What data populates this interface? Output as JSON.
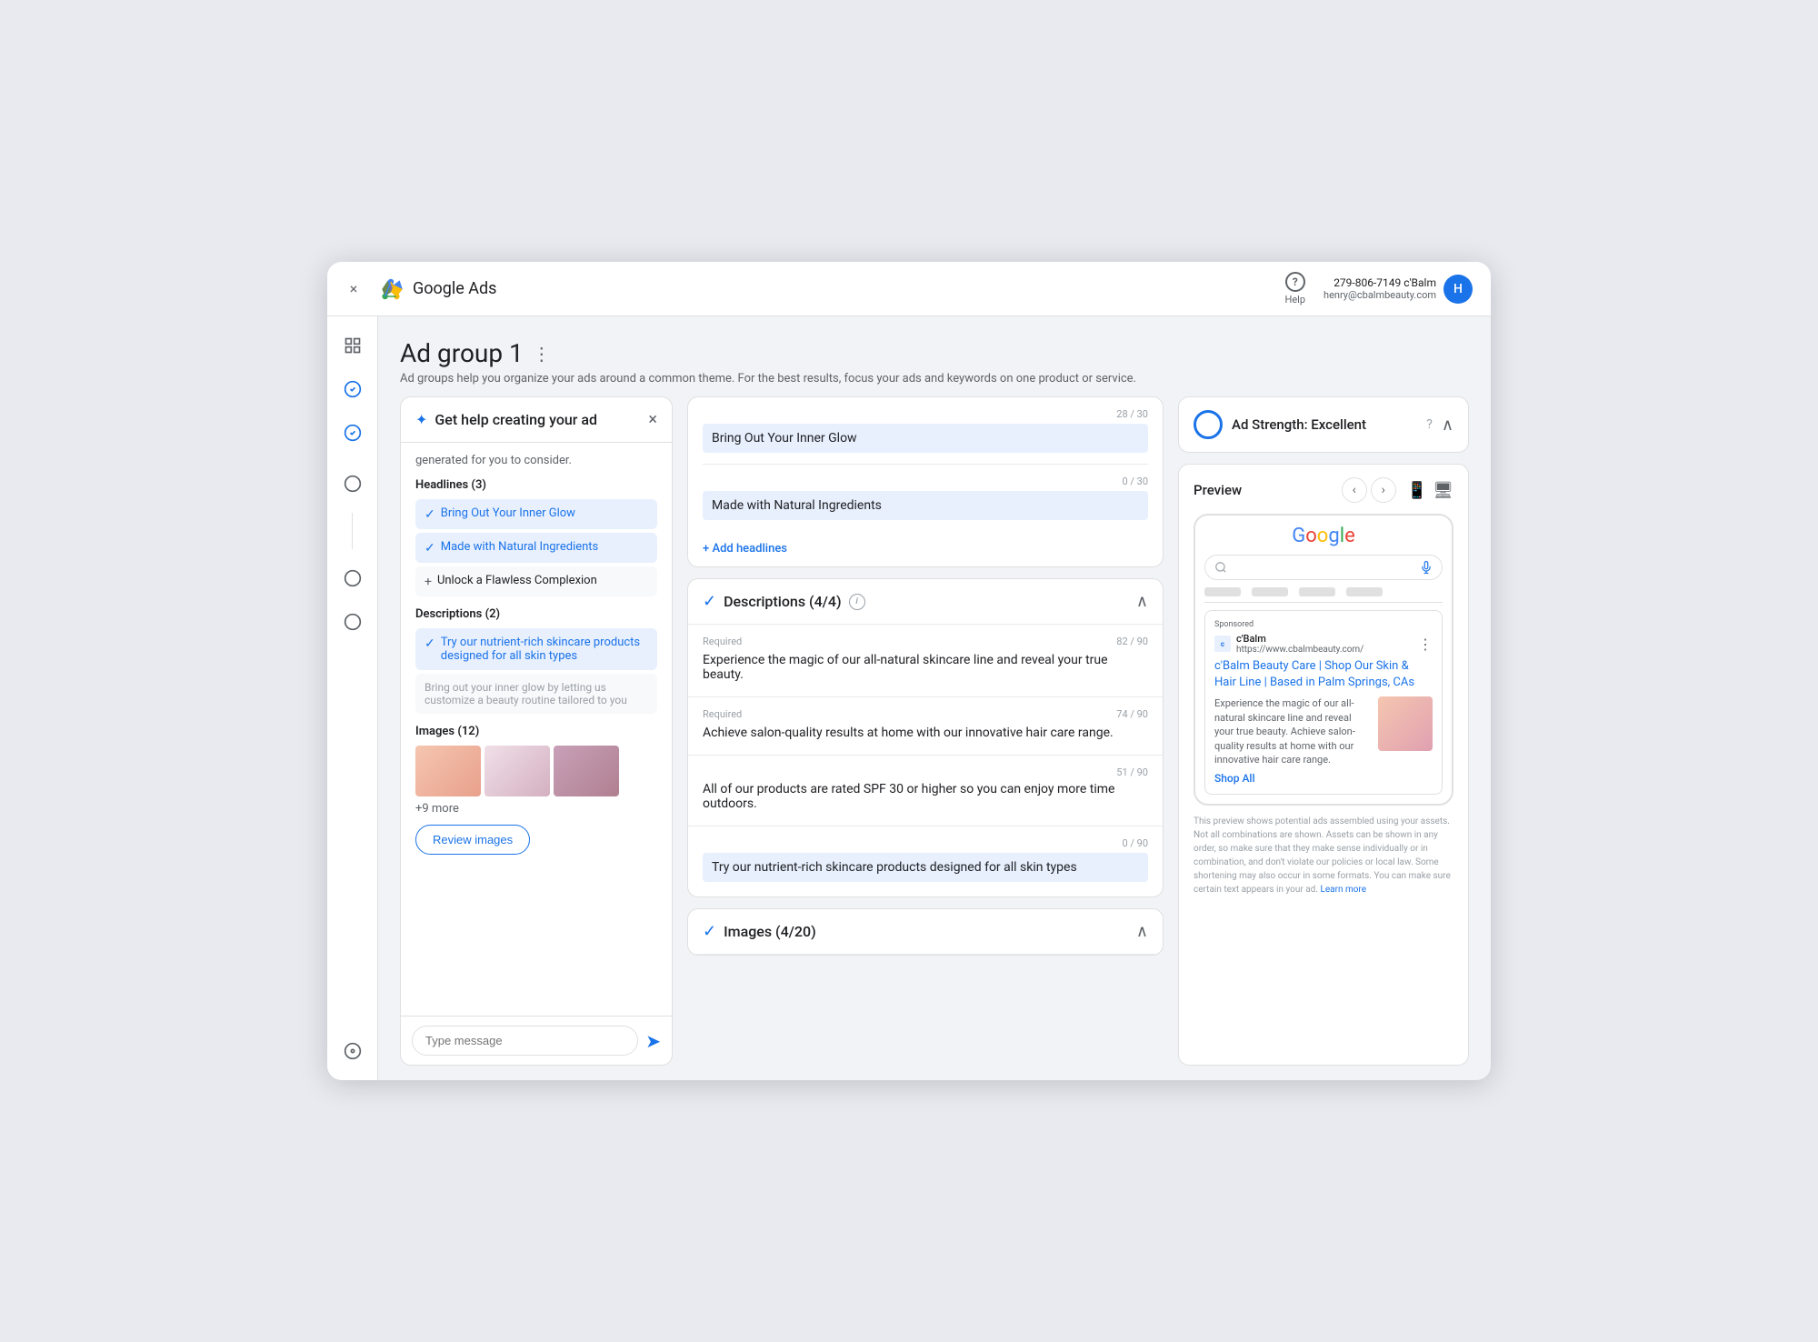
{
  "topbar": {
    "close_label": "×",
    "logo_text": "Google Ads",
    "help_label": "Help",
    "account_phone": "279-806-7149 c'Balm",
    "account_email": "henry@cbalmbeauty.com",
    "account_initial": "H"
  },
  "sidebar": {
    "icons": [
      "☰",
      "✓",
      "✓",
      "○",
      "○",
      "○"
    ]
  },
  "page": {
    "title": "Ad group 1",
    "subtitle": "Ad groups help you organize your ads around a common theme. For the best results, focus your ads and keywords on one product or service."
  },
  "left_panel": {
    "title": "Get help creating your ad",
    "generated_text": "generated for you to consider.",
    "headlines_label": "Headlines (3)",
    "headlines": [
      {
        "text": "Bring Out Your Inner Glow",
        "selected": true
      },
      {
        "text": "Made with Natural Ingredients",
        "selected": true
      },
      {
        "text": "Unlock a Flawless Complexion",
        "selected": false
      }
    ],
    "descriptions_label": "Descriptions (2)",
    "descriptions": [
      {
        "text": "Try our nutrient-rich skincare products designed for all skin types",
        "selected": true
      },
      {
        "text": "Bring out your inner glow by letting us customize a beauty routine tailored to you",
        "selected": false
      }
    ],
    "images_label": "Images (12)",
    "more_images": "+9 more",
    "review_button": "Review images",
    "message_placeholder": "Type message"
  },
  "middle": {
    "headline_fields": [
      {
        "count": "28 / 30",
        "value": "Bring Out Your Inner Glow"
      },
      {
        "count": "0 / 30",
        "value": "Made with Natural Ingredients"
      }
    ],
    "add_headlines_label": "+ Add headlines",
    "descriptions_section": {
      "title": "Descriptions (4/4)",
      "fields": [
        {
          "label": "Required",
          "count": "82 / 90",
          "value": "Experience the magic of our all-natural skincare line and reveal your true beauty.",
          "highlighted": false
        },
        {
          "label": "Required",
          "count": "74 / 90",
          "value": "Achieve salon-quality results at home with our innovative hair care range.",
          "highlighted": false
        },
        {
          "label": "",
          "count": "51 / 90",
          "value": "All of our products are rated SPF 30 or higher so you can enjoy more time outdoors.",
          "highlighted": false
        },
        {
          "label": "",
          "count": "0 / 90",
          "value": "Try our nutrient-rich skincare products designed for all skin types",
          "highlighted": true
        }
      ]
    },
    "images_section": {
      "title": "Images (4/20)"
    }
  },
  "right_panel": {
    "strength_label": "Ad Strength: Excellent",
    "preview_label": "Preview",
    "ad": {
      "sponsored": "Sponsored",
      "source_name": "c'Balm",
      "source_url": "https://www.cbalmbeauty.com/",
      "headline": "c'Balm Beauty Care | Shop Our Skin & Hair Line | Based in Palm Springs, CAs",
      "body1": "Experience the magic of our all-natural skincare line and reveal your true beauty. Achieve salon-quality results at home with our innovative hair care range.",
      "shop_label": "Shop All"
    },
    "disclaimer": "This preview shows potential ads assembled using your assets. Not all combinations are shown. Assets can be shown in any order, so make sure that they make sense individually or in combination, and don't violate our policies or local law. Some shortening may also occur in some formats. You can make sure certain text appears in your ad.",
    "learn_more": "Learn more"
  }
}
